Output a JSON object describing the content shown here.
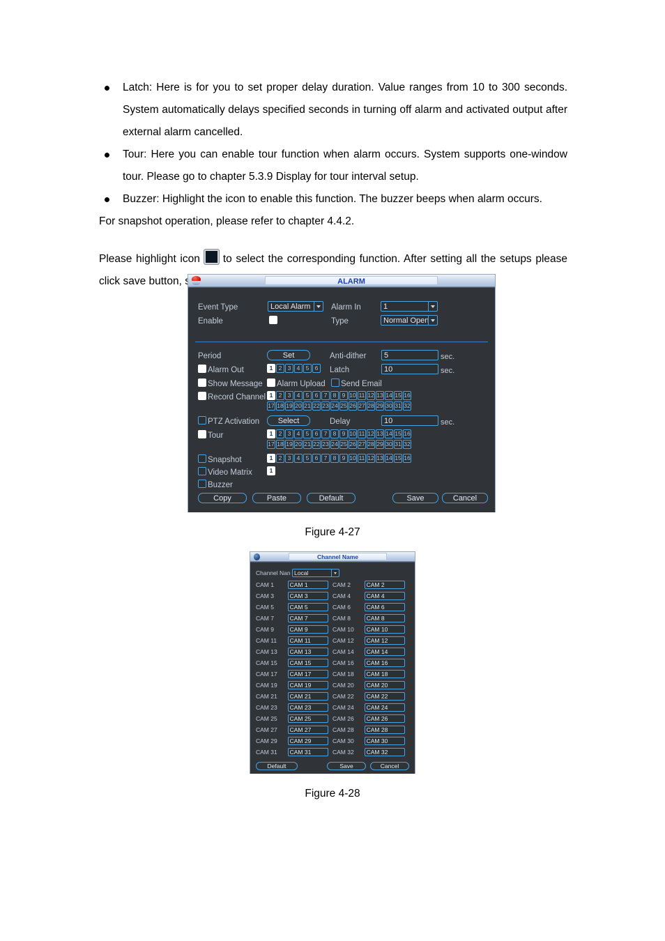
{
  "document": {
    "bullets": [
      "Latch: Here is for you to set proper delay duration. Value ranges from 10 to 300 seconds. System automatically delays specified seconds in turning off alarm and activated output after external alarm cancelled.",
      "Tour: Here you can enable tour function when alarm occurs.   System supports one-window tour. Please go to chapter 5.3.9 Display for tour interval setup.",
      "Buzzer: Highlight the icon to enable this function. The buzzer beeps when alarm occurs."
    ],
    "snapshot_line": "For snapshot operation, please refer to chapter 4.4.2.",
    "paragraph_before_icon": "Please  highlight  icon",
    "paragraph_after_icon": "to  select  the  corresponding  function.  After  setting  all  the setups please click save button, system goes back to the previous menu.",
    "figure_27_caption": "Figure 4-27",
    "figure_28_caption": "Figure 4-28"
  },
  "alarm_dialog": {
    "title": "ALARM",
    "event_type_label": "Event Type",
    "event_type_value": "Local Alarm",
    "alarm_in_label": "Alarm In",
    "alarm_in_value": "1",
    "enable_label": "Enable",
    "enable_checked": true,
    "type_label": "Type",
    "type_value": "Normal Open",
    "period_label": "Period",
    "period_button": "Set",
    "anti_dither_label": "Anti-dither",
    "anti_dither_value": "5",
    "anti_dither_unit": "sec.",
    "alarm_out_label": "Alarm Out",
    "alarm_out_checked": true,
    "alarm_out_channels": [
      "1",
      "2",
      "3",
      "4",
      "5",
      "6"
    ],
    "alarm_out_active": [
      "1"
    ],
    "latch_label": "Latch",
    "latch_value": "10",
    "latch_unit": "sec.",
    "show_message_label": "Show Message",
    "show_message_checked": true,
    "alarm_upload_label": "Alarm Upload",
    "alarm_upload_checked": true,
    "send_email_label": "Send Email",
    "send_email_checked": false,
    "record_channel_label": "Record Channel",
    "record_channel_checked": true,
    "record_channels_row1": [
      "1",
      "2",
      "3",
      "4",
      "5",
      "6",
      "7",
      "8",
      "9",
      "10",
      "11",
      "12",
      "13",
      "14",
      "15",
      "16"
    ],
    "record_channels_row2": [
      "17",
      "18",
      "19",
      "20",
      "21",
      "22",
      "23",
      "24",
      "25",
      "26",
      "27",
      "28",
      "29",
      "30",
      "31",
      "32"
    ],
    "record_channel_active": [
      "1"
    ],
    "ptz_activation_label": "PTZ Activation",
    "ptz_activation_checked": false,
    "ptz_select_button": "Select",
    "delay_label": "Delay",
    "delay_value": "10",
    "delay_unit": "sec.",
    "tour_label": "Tour",
    "tour_checked": true,
    "tour_channels_row1": [
      "1",
      "2",
      "3",
      "4",
      "5",
      "6",
      "7",
      "8",
      "9",
      "10",
      "11",
      "12",
      "13",
      "14",
      "15",
      "16"
    ],
    "tour_channels_row2": [
      "17",
      "18",
      "19",
      "20",
      "21",
      "22",
      "23",
      "24",
      "25",
      "26",
      "27",
      "28",
      "29",
      "30",
      "31",
      "32"
    ],
    "tour_active": [
      "1"
    ],
    "snapshot_label": "Snapshot",
    "snapshot_checked": false,
    "snapshot_channels": [
      "1",
      "2",
      "3",
      "4",
      "5",
      "6",
      "7",
      "8",
      "9",
      "10",
      "11",
      "12",
      "13",
      "14",
      "15",
      "16"
    ],
    "snapshot_active": [
      "1"
    ],
    "video_matrix_label": "Video Matrix",
    "video_matrix_checked": false,
    "video_matrix_channels": [
      "1"
    ],
    "video_matrix_active": [
      "1"
    ],
    "buzzer_label": "Buzzer",
    "buzzer_checked": false,
    "copy_button": "Copy",
    "paste_button": "Paste",
    "default_button": "Default",
    "save_button": "Save",
    "cancel_button": "Cancel"
  },
  "channel_dialog": {
    "title": "Channel Name",
    "channel_name_label": "Channel Nan",
    "channel_name_value": "Local",
    "rows": [
      {
        "l1": "CAM 1",
        "v1": "CAM 1",
        "l2": "CAM 2",
        "v2": "CAM 2"
      },
      {
        "l1": "CAM 3",
        "v1": "CAM 3",
        "l2": "CAM 4",
        "v2": "CAM 4"
      },
      {
        "l1": "CAM 5",
        "v1": "CAM 5",
        "l2": "CAM 6",
        "v2": "CAM 6"
      },
      {
        "l1": "CAM 7",
        "v1": "CAM 7",
        "l2": "CAM 8",
        "v2": "CAM 8"
      },
      {
        "l1": "CAM 9",
        "v1": "CAM 9",
        "l2": "CAM 10",
        "v2": "CAM 10"
      },
      {
        "l1": "CAM 11",
        "v1": "CAM 11",
        "l2": "CAM 12",
        "v2": "CAM 12"
      },
      {
        "l1": "CAM 13",
        "v1": "CAM 13",
        "l2": "CAM 14",
        "v2": "CAM 14"
      },
      {
        "l1": "CAM 15",
        "v1": "CAM 15",
        "l2": "CAM 16",
        "v2": "CAM 16"
      },
      {
        "l1": "CAM 17",
        "v1": "CAM 17",
        "l2": "CAM 18",
        "v2": "CAM 18"
      },
      {
        "l1": "CAM 19",
        "v1": "CAM 19",
        "l2": "CAM 20",
        "v2": "CAM 20"
      },
      {
        "l1": "CAM 21",
        "v1": "CAM 21",
        "l2": "CAM 22",
        "v2": "CAM 22"
      },
      {
        "l1": "CAM 23",
        "v1": "CAM 23",
        "l2": "CAM 24",
        "v2": "CAM 24"
      },
      {
        "l1": "CAM 25",
        "v1": "CAM 25",
        "l2": "CAM 26",
        "v2": "CAM 26"
      },
      {
        "l1": "CAM 27",
        "v1": "CAM 27",
        "l2": "CAM 28",
        "v2": "CAM 28"
      },
      {
        "l1": "CAM 29",
        "v1": "CAM 29",
        "l2": "CAM 30",
        "v2": "CAM 30"
      },
      {
        "l1": "CAM 31",
        "v1": "CAM 31",
        "l2": "CAM 32",
        "v2": "CAM 32"
      }
    ],
    "default_button": "Default",
    "save_button": "Save",
    "cancel_button": "Cancel"
  },
  "colors": {
    "accent_blue": "#4aa3e0",
    "dialog_bg": "#303438",
    "label_text": "#c2ccd8",
    "title_text": "#1b3fa8"
  }
}
